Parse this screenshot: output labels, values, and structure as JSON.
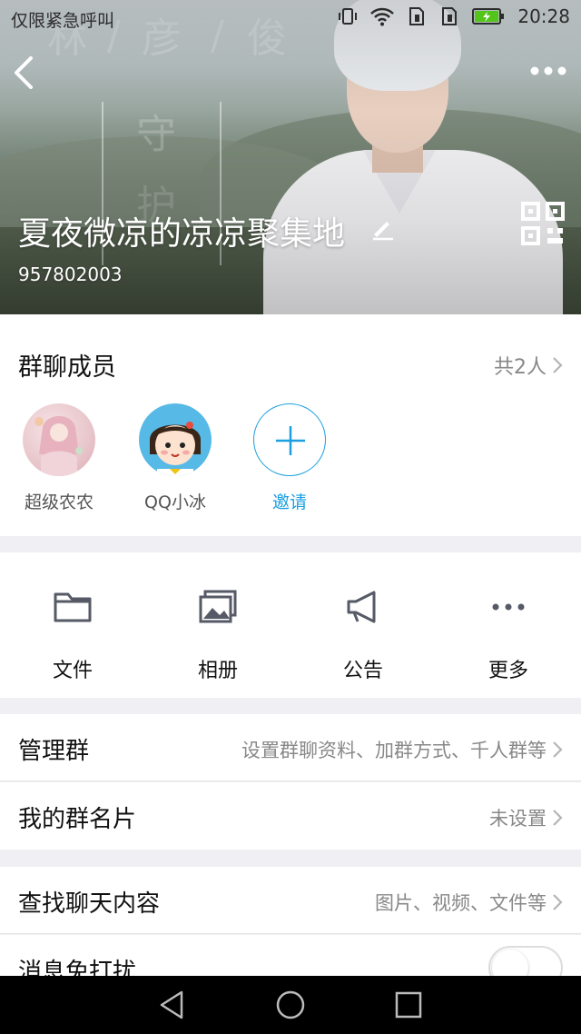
{
  "status_bar": {
    "left_text": "仅限紧急呼叫",
    "time": "20:28",
    "icons": [
      "vibrate-icon",
      "wifi-icon",
      "sim-icon",
      "sim-icon",
      "battery-charging-icon"
    ]
  },
  "header": {
    "group_name": "夏夜微凉的凉凉聚集地",
    "group_id": "957802003",
    "background_text": [
      "林",
      "/",
      "彦",
      "/",
      "俊",
      "守",
      "护"
    ]
  },
  "members": {
    "title": "群聊成员",
    "count_text": "共2人",
    "list": [
      {
        "name": "超级农农",
        "avatar": "anime-girl-avatar"
      },
      {
        "name": "QQ小冰",
        "avatar": "cartoon-girl-avatar"
      }
    ],
    "invite_label": "邀请"
  },
  "tools": [
    {
      "label": "文件",
      "icon": "folder-icon"
    },
    {
      "label": "相册",
      "icon": "photo-album-icon"
    },
    {
      "label": "公告",
      "icon": "megaphone-icon"
    },
    {
      "label": "更多",
      "icon": "more-dots-icon"
    }
  ],
  "rows": {
    "manage": {
      "label": "管理群",
      "value": "设置群聊资料、加群方式、千人群等"
    },
    "card": {
      "label": "我的群名片",
      "value": "未设置"
    },
    "search": {
      "label": "查找聊天内容",
      "value": "图片、视频、文件等"
    },
    "dnd": {
      "label": "消息免打扰",
      "enabled": false
    }
  },
  "colors": {
    "accent": "#1b9fe0",
    "background": "#efeff4",
    "secondary_text": "#888888"
  }
}
